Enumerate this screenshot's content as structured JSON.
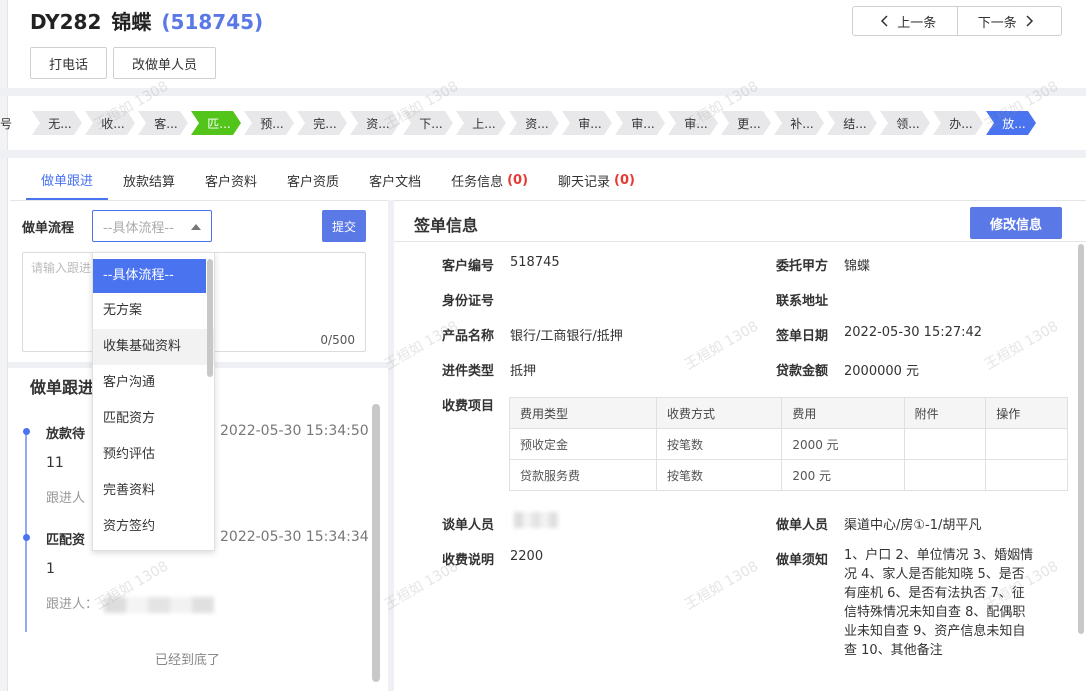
{
  "header": {
    "code": "DY282",
    "name": "锦蝶",
    "customer_id": "(518745)",
    "prev_label": "上一条",
    "next_label": "下一条"
  },
  "actions": {
    "call": "打电话",
    "change_staff": "改做单人员"
  },
  "stages": {
    "lead": "号",
    "items": [
      "无...",
      "收...",
      "客...",
      "匹...",
      "预...",
      "完...",
      "资...",
      "下...",
      "上...",
      "资...",
      "审...",
      "审...",
      "审...",
      "更...",
      "补...",
      "结...",
      "领...",
      "办...",
      "放..."
    ],
    "active_index": 3,
    "last_index": 18
  },
  "tabs": [
    {
      "label": "做单跟进",
      "count": ""
    },
    {
      "label": "放款结算",
      "count": ""
    },
    {
      "label": "客户资料",
      "count": ""
    },
    {
      "label": "客户资质",
      "count": ""
    },
    {
      "label": "客户文档",
      "count": ""
    },
    {
      "label": "任务信息",
      "count": "(0)"
    },
    {
      "label": "聊天记录",
      "count": "(0)"
    }
  ],
  "flow": {
    "label": "做单流程",
    "select_placeholder": "--具体流程--",
    "submit": "提交",
    "textarea_placeholder": "请输入跟进",
    "char_count": "0/500",
    "options": [
      "--具体流程--",
      "无方案",
      "收集基础资料",
      "客户沟通",
      "匹配资方",
      "预约评估",
      "完善资料",
      "资方签约"
    ]
  },
  "tracking": {
    "title": "做单跟进",
    "entries": [
      {
        "name": "放款待",
        "time": "2022-05-30 15:34:50",
        "value": "11",
        "follow": "跟进人"
      },
      {
        "name": "匹配资",
        "time": "2022-05-30 15:34:34",
        "value": "1",
        "follow": "跟进人："
      }
    ],
    "bottom_note": "已经到底了"
  },
  "sign": {
    "title": "签单信息",
    "edit_button": "修改信息",
    "fields": {
      "customer_no_label": "客户编号",
      "customer_no": "518745",
      "client_label": "委托甲方",
      "client": "锦蝶",
      "id_label": "身份证号",
      "id": "",
      "address_label": "联系地址",
      "address": "",
      "product_label": "产品名称",
      "product": "银行/工商银行/抵押",
      "sign_date_label": "签单日期",
      "sign_date": "2022-05-30 15:27:42",
      "type_label": "进件类型",
      "type": "抵押",
      "amount_label": "贷款金额",
      "amount": "2000000 元",
      "fees_label": "收费项目",
      "negotiator_label": "谈单人员",
      "negotiator": "",
      "operator_label": "做单人员",
      "operator": "渠道中心/房①-1/胡平凡",
      "fee_desc_label": "收费说明",
      "fee_desc": "2200",
      "notes_label": "做单须知",
      "notes": "1、户口 2、单位情况 3、婚姻情况 4、家人是否能知晓 5、是否有座机 6、是否有法执否 7、征信特殊情况未知自查 8、配偶职业未知自查 9、资产信息未知自查 10、其他备注"
    },
    "fee_table": {
      "headers": [
        "费用类型",
        "收费方式",
        "费用",
        "附件",
        "操作"
      ],
      "rows": [
        [
          "预收定金",
          "按笔数",
          "2000 元",
          "",
          ""
        ],
        [
          "贷款服务费",
          "按笔数",
          "200 元",
          "",
          ""
        ]
      ]
    }
  },
  "watermark": "王桓如 1308",
  "colors": {
    "primary": "#4a73f0",
    "active_stage": "#52c41a",
    "danger": "#e53935"
  }
}
